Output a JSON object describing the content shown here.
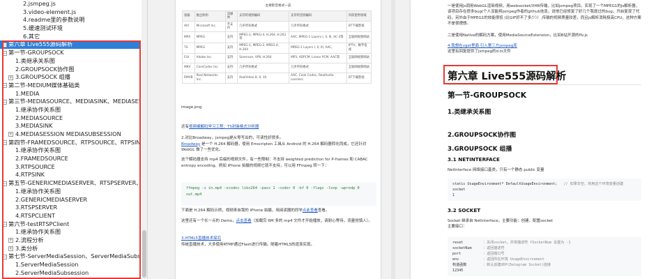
{
  "sidebar": {
    "items": [
      {
        "label": "2.jsmpeg.js",
        "toggle": ""
      },
      {
        "label": "3.video-element.js",
        "toggle": ""
      },
      {
        "label": "4.readme里的参数说明",
        "toggle": ""
      },
      {
        "label": "5.缓速测试环境",
        "toggle": ""
      },
      {
        "label": "6.其它",
        "toggle": ""
      },
      {
        "label": "第六章 Live555源码解析",
        "toggle": "−"
      },
      {
        "label": "第一节-GROUPSOCK",
        "toggle": "−"
      },
      {
        "label": "1.类继承关系图",
        "toggle": ""
      },
      {
        "label": "2.GROUPSOCK协作图",
        "toggle": ""
      },
      {
        "label": "3.GROUPSOCK 组播",
        "toggle": "+"
      },
      {
        "label": "第二节-MEDIUM媒体基础类",
        "toggle": "−"
      },
      {
        "label": "1.MEDIA",
        "toggle": ""
      },
      {
        "label": "第三节-MEDIASOURCE、MEDIASINK、MEDIASESS",
        "toggle": "−"
      },
      {
        "label": "1.继承协作关系图",
        "toggle": ""
      },
      {
        "label": "2.MEDIASOURCE",
        "toggle": ""
      },
      {
        "label": "3.MEDIASINK",
        "toggle": ""
      },
      {
        "label": "4.MEDIASESSION MEDIASUBSESSION",
        "toggle": "+"
      },
      {
        "label": "第四节-FRAMEDSOURCE、RTPSOURCE、RTPSINK",
        "toggle": "−"
      },
      {
        "label": "1.继承协作关系图",
        "toggle": ""
      },
      {
        "label": "2.FRAMEDSOURCE",
        "toggle": ""
      },
      {
        "label": "3.RTPSOURCE",
        "toggle": ""
      },
      {
        "label": "4.RTPSINK",
        "toggle": ""
      },
      {
        "label": "第五节-GENERICMEDIASERVER、RTSPSERVER、RTS",
        "toggle": "−"
      },
      {
        "label": "1.继承协作关系图",
        "toggle": ""
      },
      {
        "label": "2.GENERICMEDIASERVER",
        "toggle": ""
      },
      {
        "label": "3.RTSPSERVER",
        "toggle": ""
      },
      {
        "label": "4.RTSPCLIENT",
        "toggle": ""
      },
      {
        "label": "第六节-testRTSPClient",
        "toggle": "−"
      },
      {
        "label": "1.继承协作关系图",
        "toggle": ""
      },
      {
        "label": "2.流程分析",
        "toggle": "+"
      },
      {
        "label": "3.类分析",
        "toggle": "+"
      },
      {
        "label": "第七节-ServerMediaSession、ServerMediaSubsessi",
        "toggle": "−"
      },
      {
        "label": "1.ServerMediaSession",
        "toggle": ""
      },
      {
        "label": "2.ServerMediaSubsession",
        "toggle": ""
      }
    ]
  },
  "page1": {
    "table_caption": "主要影音格式一览",
    "headers": [
      "容器",
      "推出机构",
      "流媒体",
      "支持的视频编码",
      "支持的音频编码",
      "目前使用领域"
    ],
    "rows": [
      [
        "AVI",
        "Microsoft Inc.",
        "不支持",
        "几乎所有格式",
        "几乎所有格式",
        "BT下载影视"
      ],
      [
        "MP4",
        "MPEG",
        "支持",
        "MPEG-2, MPEG-4, H.264, H.263等",
        "AAC, MPEG-1 Layers I, II, III, AC-3等",
        "互联网视频网站"
      ],
      [
        "TS",
        "MPEG",
        "支持",
        "MPEG-1, MPEG-2, MPEG-4, H.264",
        "MPEG-1 Layers I, II, III, AAC,",
        "IPTV，数字电视"
      ],
      [
        "FLV",
        "Adobe Inc.",
        "支持",
        "Sorenson, VP6, H.264",
        "MP3, ADPCM, Linear PCM, AAC等",
        "互联网视频网站"
      ],
      [
        "MKV",
        "CoreCodec Inc.",
        "支持",
        "几乎所有格式",
        "几乎所有格式",
        "互联网视频网站"
      ],
      [
        "RMVB",
        "Real Networks Inc.",
        "支持",
        "RealVideo 8, 9, 10",
        "AAC, Cook Codec, RealAudio Lossless",
        "BT下载影视"
      ]
    ],
    "image_label": "image.png",
    "p_ts_prefix": "还有",
    "p_ts_link": "视频编解码学习工程：TS封装格式分析器",
    "p_broadway_1": "2.对比Broadway，jsmpeg是从零写出的，可读性好很多。",
    "p_broadway_link": "Broadway",
    "p_broadway_2": " 是一个 H.264 解码器，使用 Emscripten 工具从 Android 的 H.264 解码器转化而成，它还针对 WebGL 做了一些优化。",
    "p_mp4": "这个解码器支持 mp4 后缀的视频文件，有一些限制：不支持 weighted prediction for P-frames 和 CABAC entropy encoding。例如 iPhone 拍摄的视频它就不支持，可以用 FFmpeg 转一下：",
    "code": "ffmpeg -i in.mp4 -vcodec libx264 -pass 1 -coder 0 -bf 0 -flags -loop -wpredp 0 out.mp4",
    "p_demo1_prefix": "下面是 H.264 解码示例，视频来自我的 iPhone 拍摄，用阅读器的同学",
    "p_demo1_link": "点此查看",
    "p_demo1_suffix": "查看。",
    "p_demo2_prefix": "这里还有一个长一点的 Demo，",
    "p_demo2_link": "点击查看",
    "p_demo2_suffix": "（加载完 6M 多的 mp4 文件才开始播放，请耐心等待，流量党慎入）。",
    "p_html5_num": "3.",
    "p_html5_link": "HTML5直播技术探究",
    "p_html5_text": "传统直播技术，大多使用RTMP通过Flash进行传输。随着HTML5的逐渐实现。"
  },
  "page2": {
    "intro1": "一是使用js调用WebGL渲染视频，用websocket/XHR传输，比如jsmpeg项目。实现了一个MPEG1的js解析器，该项目存在很多bug(个人没能将jsmpeg作者的github信息，说他已经修复了好几个我提过的bug，开启复现了代码，另外由于MPEG1的效能很低 (比GIF好不了多少））,传输的视频质量较差，而且js解析消耗极高CPU，这种方案不是很理想。",
    "intro2": "二是使用Native的解码方案，使用MediaSourceExtension，比如B站开源的flv.js",
    "p4_num": "4.",
    "p4_link": "我想在vget里面 引入第三方jsmpeg库",
    "p4_text": "这里有回复提供了jsmpeg的d.ts文件",
    "chapter_title": "第六章 Live555源码解析",
    "section1": "第一节-GROUPSOCK",
    "s1": "1.类继承关系图",
    "s2": "2.GROUPSOCK协作图",
    "s3": "3.GROUPSOCK 组播",
    "s31": "3.1 NETINTERFACE",
    "s31_text": "NetInterface 网络接口基类，只有一个静态 public 变量",
    "code_a1": "static UsageEnvironment* DefaultUsageEnvironment;",
    "code_a1_cm": "// 如果非空，将用这个环境变量创建",
    "code_a2": "socket",
    "code_a3": "1",
    "s32": "3.2 SOCKET",
    "s32_text1": "Socket 继承自 NetInterface，主要功能：创建、配置socket",
    "s32_text2": "主要接口：",
    "code_b": [
      {
        "k": "reset",
        "c": "：关闭socket，并将描述符 fSocketNum 设置为 -1"
      },
      {
        "k": "socketNum",
        "c": "：返回描述符"
      },
      {
        "k": "port",
        "c": "：返回端口号"
      },
      {
        "k": "env",
        "c": "：返回所在环境 UsageEnvironment"
      },
      {
        "k": "构造函数",
        "c": "：默认创建UDP(Datagram Socket)连接"
      },
      {
        "k": "12345",
        "c": ""
      }
    ]
  }
}
